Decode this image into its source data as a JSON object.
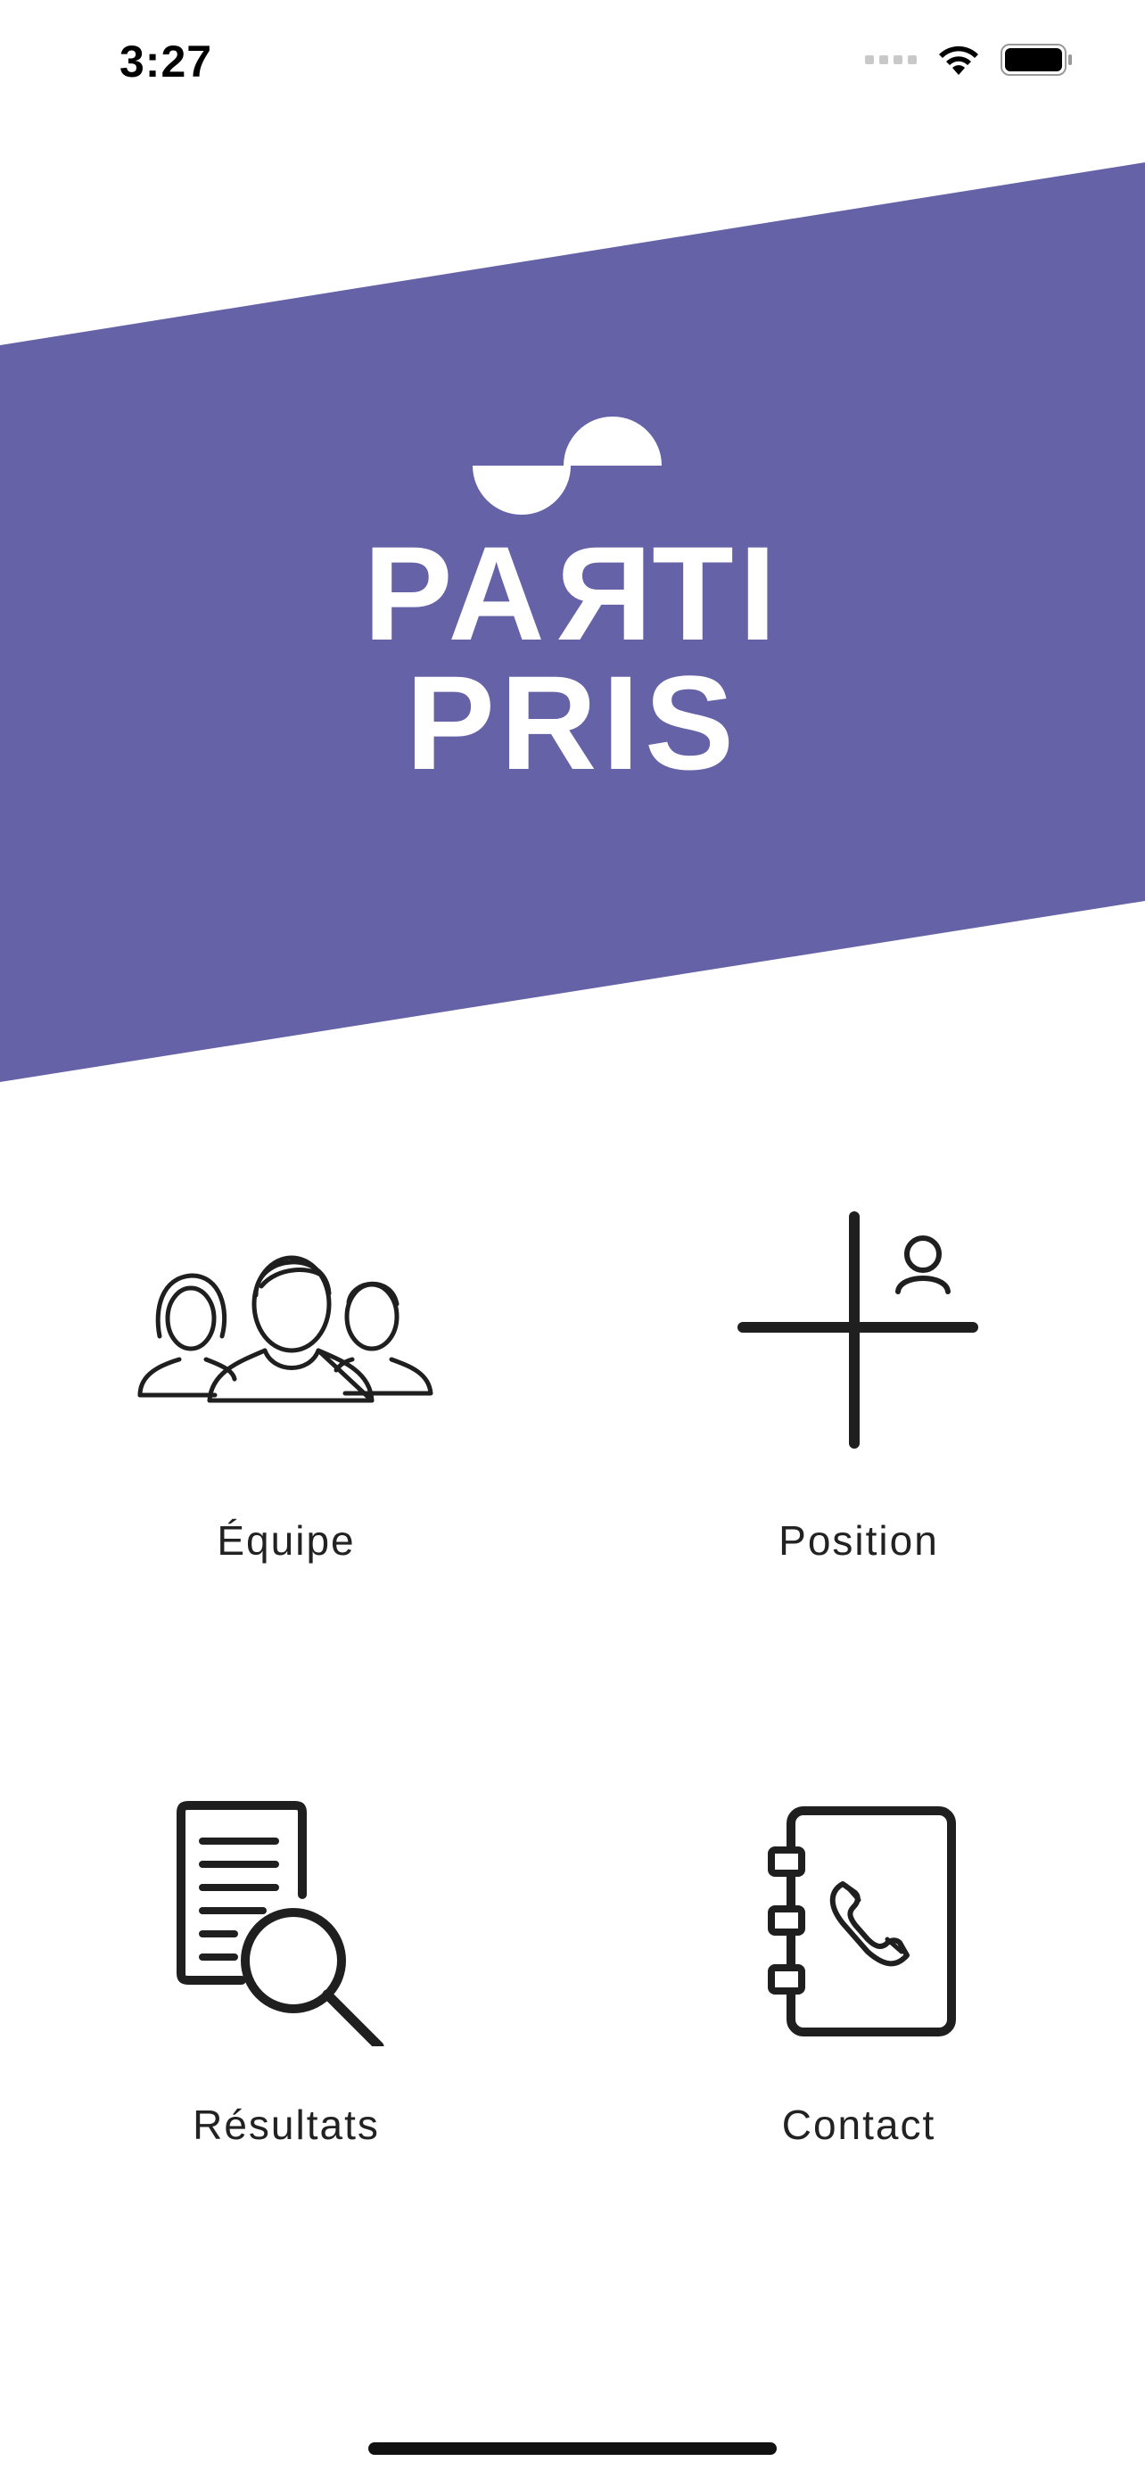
{
  "status_bar": {
    "time": "3:27",
    "signal_icon": "cellular-signal-icon",
    "wifi_icon": "wifi-icon",
    "battery_icon": "battery-icon"
  },
  "brand": {
    "name_line1_a": "PA",
    "name_line1_r": "R",
    "name_line1_b": "TI",
    "name_line2": "PRIS",
    "banner_color": "#6562a8"
  },
  "menu": {
    "items": [
      {
        "label": "Équipe",
        "icon": "team-icon"
      },
      {
        "label": "Position",
        "icon": "position-crosshair-icon"
      },
      {
        "label": "Résultats",
        "icon": "document-search-icon"
      },
      {
        "label": "Contact",
        "icon": "address-book-phone-icon"
      }
    ]
  }
}
